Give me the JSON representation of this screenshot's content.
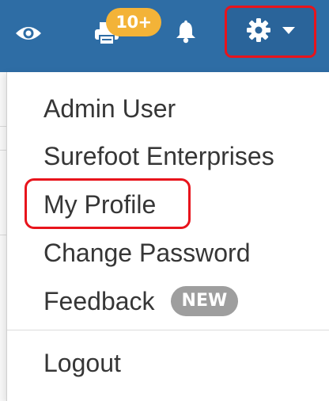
{
  "topbar": {
    "icons": {
      "view": "eye-icon",
      "print_queue": "printer-icon",
      "notifications": "bell-icon",
      "settings": "gear-icon",
      "settings_caret": "caret-down-icon"
    },
    "print_badge": "10+",
    "colors": {
      "bar": "#2e6da5",
      "badge": "#f3b338",
      "highlight": "#e8141c"
    }
  },
  "dropdown": {
    "items": [
      {
        "label": "Admin User"
      },
      {
        "label": "Surefoot Enterprises"
      },
      {
        "label": "My Profile"
      },
      {
        "label": "Change Password"
      },
      {
        "label": "Feedback",
        "badge": "NEW"
      },
      {
        "label": "Logout"
      }
    ]
  }
}
